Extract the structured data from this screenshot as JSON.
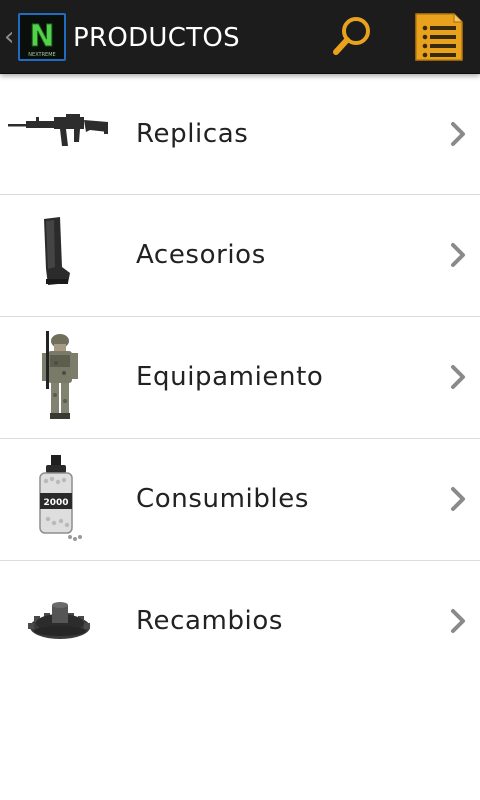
{
  "app": {
    "title": "PRODUCTOS",
    "logo_text": "N",
    "logo_subtext": "NEXTREME",
    "accent_color": "#e8a21d",
    "bar_color": "#1c1c1c",
    "back_icon": "chevron-left-icon",
    "search_icon": "search-icon",
    "menu_icon": "list-menu-icon"
  },
  "categories": [
    {
      "label": "Replicas",
      "icon": "rifle-image"
    },
    {
      "label": "Acesorios",
      "icon": "magazine-image"
    },
    {
      "label": "Equipamiento",
      "icon": "soldier-image"
    },
    {
      "label": "Consumibles",
      "icon": "bb-bottle-image"
    },
    {
      "label": "Recambios",
      "icon": "gear-image"
    }
  ],
  "consumibles_bottle_text": "2000",
  "chevron_icon": "chevron-right-icon"
}
